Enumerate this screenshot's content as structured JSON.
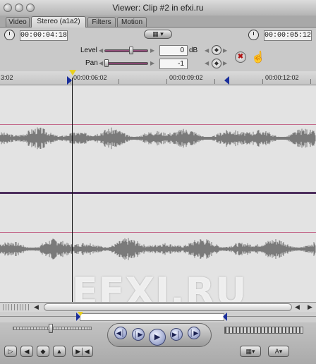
{
  "window": {
    "title": "Viewer: Clip #2 in efxi.ru"
  },
  "tabs": [
    {
      "label": "Video"
    },
    {
      "label": "Stereo (a1a2)"
    },
    {
      "label": "Filters"
    },
    {
      "label": "Motion"
    }
  ],
  "header": {
    "duration_timecode": "00:00:04:18",
    "current_timecode": "00:00:05:12",
    "level": {
      "label": "Level",
      "value": "0",
      "unit": "dB",
      "fraction": 0.62
    },
    "pan": {
      "label": "Pan",
      "value": "-1",
      "fraction": 0.0
    }
  },
  "ruler": {
    "labels": [
      "3:02",
      "00:00:06:02",
      "00:00:09:02",
      "00:00:12:02"
    ]
  },
  "watermark": "EFXI.RU",
  "transport": {
    "shuttle_fraction": 0.48
  },
  "colors": {
    "playhead": "#111111",
    "in_out_marker": "#1b2f9c",
    "waveform": "#7a7a7a",
    "level_line": "#c46b8c"
  }
}
